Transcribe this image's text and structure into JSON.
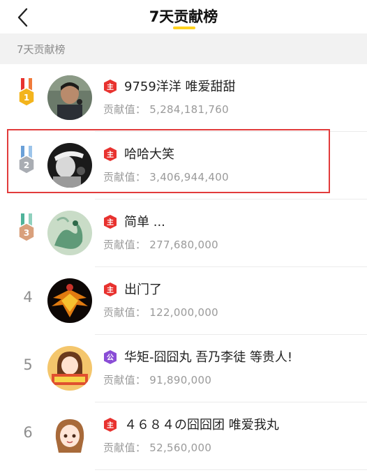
{
  "header": {
    "title": "7天贡献榜",
    "back_icon": "chevron-left-icon",
    "underline_color": "#ffd21f"
  },
  "section": {
    "label": "7天贡献榜"
  },
  "score_label": "贡献值：",
  "colors": {
    "badge_red": "#e8322f",
    "badge_purple": "#8a4dd6",
    "highlight": "#e23b3b",
    "gold": "#f3b41c",
    "silver": "#a9adb3",
    "bronze": "#d9a07c"
  },
  "entries": [
    {
      "rank": "1",
      "medal": "gold-medal-icon",
      "badge": "主",
      "badge_type": "red",
      "name": "9759洋洋 唯爱甜甜",
      "score": "5,284,181,760",
      "avatar": "avatar-man-singing"
    },
    {
      "rank": "2",
      "medal": "silver-medal-icon",
      "badge": "主",
      "badge_type": "red",
      "name": "哈哈大笑",
      "score": "3,406,944,400",
      "avatar": "avatar-bw-portrait",
      "highlighted": true
    },
    {
      "rank": "3",
      "medal": "bronze-medal-icon",
      "badge": "主",
      "badge_type": "red",
      "name": "简单 ...",
      "score": "277,680,000",
      "avatar": "avatar-dragon"
    },
    {
      "rank": "4",
      "badge": "主",
      "badge_type": "red",
      "name": "出门了",
      "score": "122,000,000",
      "avatar": "avatar-phoenix"
    },
    {
      "rank": "5",
      "badge": "公",
      "badge_type": "purple",
      "name": "华矩-囧囧丸 吾乃李徒 等贵人!",
      "score": "91,890,000",
      "avatar": "avatar-cartoon-girl"
    },
    {
      "rank": "6",
      "badge": "主",
      "badge_type": "red",
      "name": "４６８４の囧囧团 唯爱我丸",
      "score": "52,560,000",
      "avatar": "avatar-anime-girl"
    }
  ]
}
